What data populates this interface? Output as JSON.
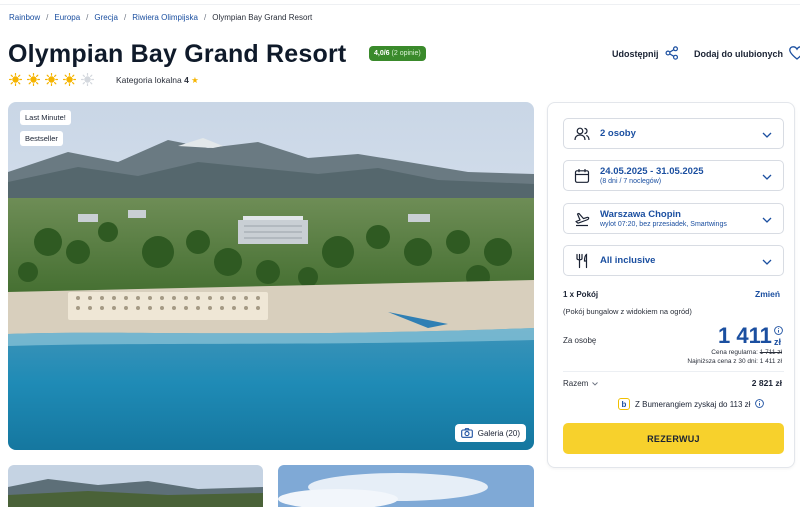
{
  "breadcrumb": {
    "items": [
      "Rainbow",
      "Europa",
      "Grecja",
      "Riwiera Olimpijska"
    ],
    "current": "Olympian Bay Grand Resort",
    "separator": "/"
  },
  "hotel": {
    "name": "Olympian Bay Grand Resort",
    "rating_score": "4,0/6",
    "rating_count": "(2 opinie)",
    "suns_filled": 4,
    "suns_total": 5,
    "category_label": "Kategoria lokalna",
    "category_value": "4",
    "category_star": "★"
  },
  "actions": {
    "share_label": "Udostępnij",
    "favorite_label": "Dodaj do ulubionych"
  },
  "hero": {
    "tags": [
      "Last Minute!",
      "Bestseller"
    ],
    "gallery_label": "Galeria (20)"
  },
  "booking": {
    "guests": "2 osoby",
    "dates": "24.05.2025 - 31.05.2025",
    "dates_sub": "(8 dni / 7 noclegów)",
    "departure": "Warszawa Chopin",
    "departure_sub": "wylot 07:20, bez przesiadek, Smartwings",
    "board": "All inclusive",
    "room_count": "1 x Pokój",
    "room_change": "Zmień",
    "room_desc": "(Pokój bungalow z widokiem na ogród)",
    "per_person_label": "Za osobę",
    "price": "1 411",
    "currency": "zł",
    "regular_label": "Cena regularna:",
    "regular_price": "1 711 zł",
    "lowest_label": "Najniższa cena z 30 dni:",
    "lowest_price": "1 411 zł",
    "total_label": "Razem",
    "total_value": "2 821 zł",
    "bumerang_text": "Z Bumerangiem zyskaj do 113 zł",
    "reserve_label": "REZERWUJ"
  },
  "colors": {
    "brand_blue": "#1b4fa0",
    "reserve_yellow": "#f7d12c",
    "rating_green": "#3a8a2b",
    "sun_yellow": "#f5b400"
  }
}
